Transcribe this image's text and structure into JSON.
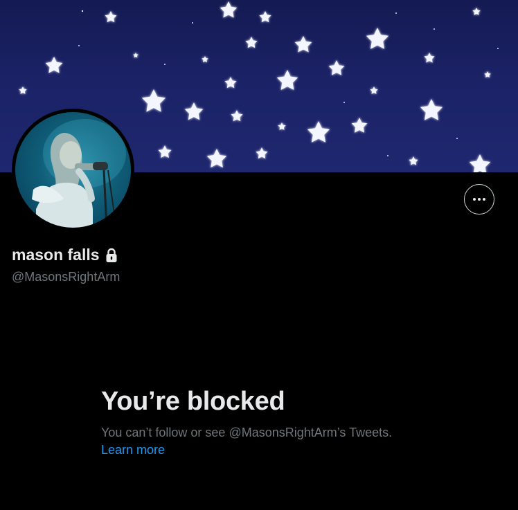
{
  "profile": {
    "display_name": "mason falls",
    "handle": "@MasonsRightArm",
    "protected_icon": "lock-icon",
    "more_icon": "more-horizontal-icon"
  },
  "blocked": {
    "title": "You’re blocked",
    "description": "You can’t follow or see @MasonsRightArm’s Tweets.",
    "learn_more": "Learn more"
  },
  "colors": {
    "background": "#000000",
    "primary_text": "#e7e9ea",
    "secondary_text": "#71767b",
    "link": "#1d9bf0",
    "banner": "#1b2266"
  }
}
